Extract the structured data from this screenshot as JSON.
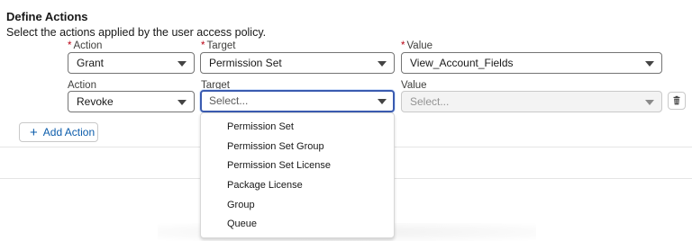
{
  "section": {
    "title": "Define Actions",
    "subtitle": "Select the actions applied by the user access policy."
  },
  "row1": {
    "action_label": "Action",
    "target_label": "Target",
    "value_label": "Value",
    "required_marker": "*",
    "action_value": "Grant",
    "target_value": "Permission Set",
    "value_value": "View_Account_Fields"
  },
  "row2": {
    "action_label": "Action",
    "target_label": "Target",
    "value_label": "Value",
    "action_value": "Revoke",
    "target_placeholder": "Select...",
    "value_placeholder": "Select..."
  },
  "add_action_label": "Add Action",
  "dropdown_options": [
    "Permission Set",
    "Permission Set Group",
    "Permission Set License",
    "Package License",
    "Group",
    "Queue"
  ],
  "colors": {
    "required": "#ba0517",
    "focus_border": "#3a5bb0",
    "link_blue": "#0b5cab"
  },
  "icons": {
    "dropdown": "chevron-down-icon",
    "delete": "trash-icon",
    "add": "plus-icon"
  }
}
